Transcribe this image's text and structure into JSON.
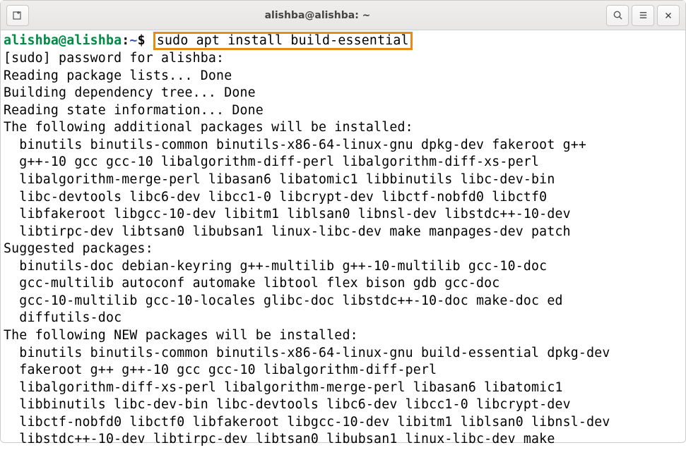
{
  "titlebar": {
    "title": "alishba@alishba: ~"
  },
  "prompt": {
    "user_host": "alishba@alishba",
    "colon": ":",
    "path": "~",
    "dollar": "$"
  },
  "command": "sudo apt install build-essential",
  "output": [
    "[sudo] password for alishba:",
    "Reading package lists... Done",
    "Building dependency tree... Done",
    "Reading state information... Done",
    "The following additional packages will be installed:",
    "  binutils binutils-common binutils-x86-64-linux-gnu dpkg-dev fakeroot g++",
    "  g++-10 gcc gcc-10 libalgorithm-diff-perl libalgorithm-diff-xs-perl",
    "  libalgorithm-merge-perl libasan6 libatomic1 libbinutils libc-dev-bin",
    "  libc-devtools libc6-dev libcc1-0 libcrypt-dev libctf-nobfd0 libctf0",
    "  libfakeroot libgcc-10-dev libitm1 liblsan0 libnsl-dev libstdc++-10-dev",
    "  libtirpc-dev libtsan0 libubsan1 linux-libc-dev make manpages-dev patch",
    "Suggested packages:",
    "  binutils-doc debian-keyring g++-multilib g++-10-multilib gcc-10-doc",
    "  gcc-multilib autoconf automake libtool flex bison gdb gcc-doc",
    "  gcc-10-multilib gcc-10-locales glibc-doc libstdc++-10-doc make-doc ed",
    "  diffutils-doc",
    "The following NEW packages will be installed:",
    "  binutils binutils-common binutils-x86-64-linux-gnu build-essential dpkg-dev",
    "  fakeroot g++ g++-10 gcc gcc-10 libalgorithm-diff-perl",
    "  libalgorithm-diff-xs-perl libalgorithm-merge-perl libasan6 libatomic1",
    "  libbinutils libc-dev-bin libc-devtools libc6-dev libcc1-0 libcrypt-dev",
    "  libctf-nobfd0 libctf0 libfakeroot libgcc-10-dev libitm1 liblsan0 libnsl-dev",
    "  libstdc++-10-dev libtirpc-dev libtsan0 libubsan1 linux-libc-dev make"
  ]
}
